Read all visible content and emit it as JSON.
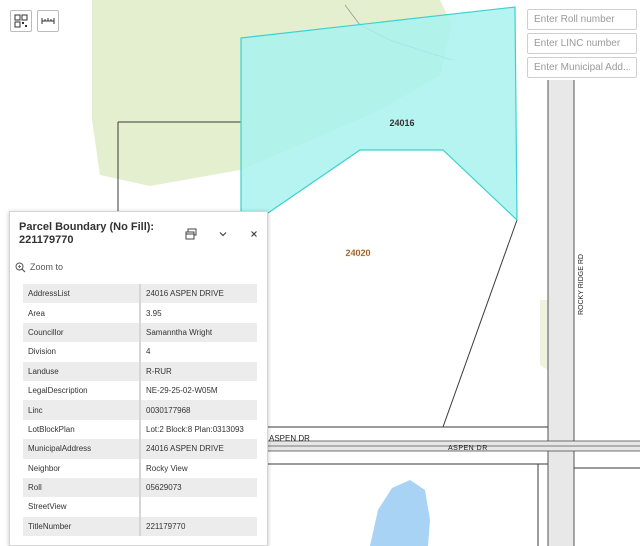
{
  "map": {
    "parcel_labels": [
      "24016",
      "24020"
    ],
    "road_labels": {
      "aspen_dr_upper": "ASPEN DR",
      "aspen_dr_lower": "ASPEN DR",
      "rocky_ridge_rd": "ROCKY RIDGE RD"
    },
    "colors": {
      "green_area": "#e4efcf",
      "selected_parcel_fill": "#a8f2ee",
      "selected_parcel_stroke": "#3ad2d0",
      "road_fill": "#e8e8e8",
      "water": "#a9d3f5",
      "parcel_line": "#3a3a3a"
    }
  },
  "toolbar": {
    "buttons": [
      {
        "name": "qr-select",
        "icon": "grid-select-icon"
      },
      {
        "name": "measure",
        "icon": "ruler-icon"
      }
    ]
  },
  "search": {
    "roll_placeholder": "Enter Roll number",
    "linc_placeholder": "Enter LINC number",
    "address_placeholder": "Enter Municipal Add..."
  },
  "popup": {
    "title": "Parcel Boundary (No Fill): 221179770",
    "zoom_label": "Zoom to",
    "attributes": [
      {
        "key": "AddressList",
        "value": "24016 ASPEN DRIVE"
      },
      {
        "key": "Area",
        "value": "3.95"
      },
      {
        "key": "Councillor",
        "value": "Samanntha Wright"
      },
      {
        "key": "Division",
        "value": "4"
      },
      {
        "key": "Landuse",
        "value": "R-RUR"
      },
      {
        "key": "LegalDescription",
        "value": "NE-29-25-02-W05M"
      },
      {
        "key": "Linc",
        "value": "0030177968"
      },
      {
        "key": "LotBlockPlan",
        "value": "Lot:2 Block:8 Plan:0313093"
      },
      {
        "key": "MunicipalAddress",
        "value": "24016 ASPEN DRIVE"
      },
      {
        "key": "Neighbor",
        "value": "Rocky View"
      },
      {
        "key": "Roll",
        "value": "05629073"
      },
      {
        "key": "StreetView",
        "value": ""
      },
      {
        "key": "TitleNumber",
        "value": "221179770"
      }
    ]
  }
}
